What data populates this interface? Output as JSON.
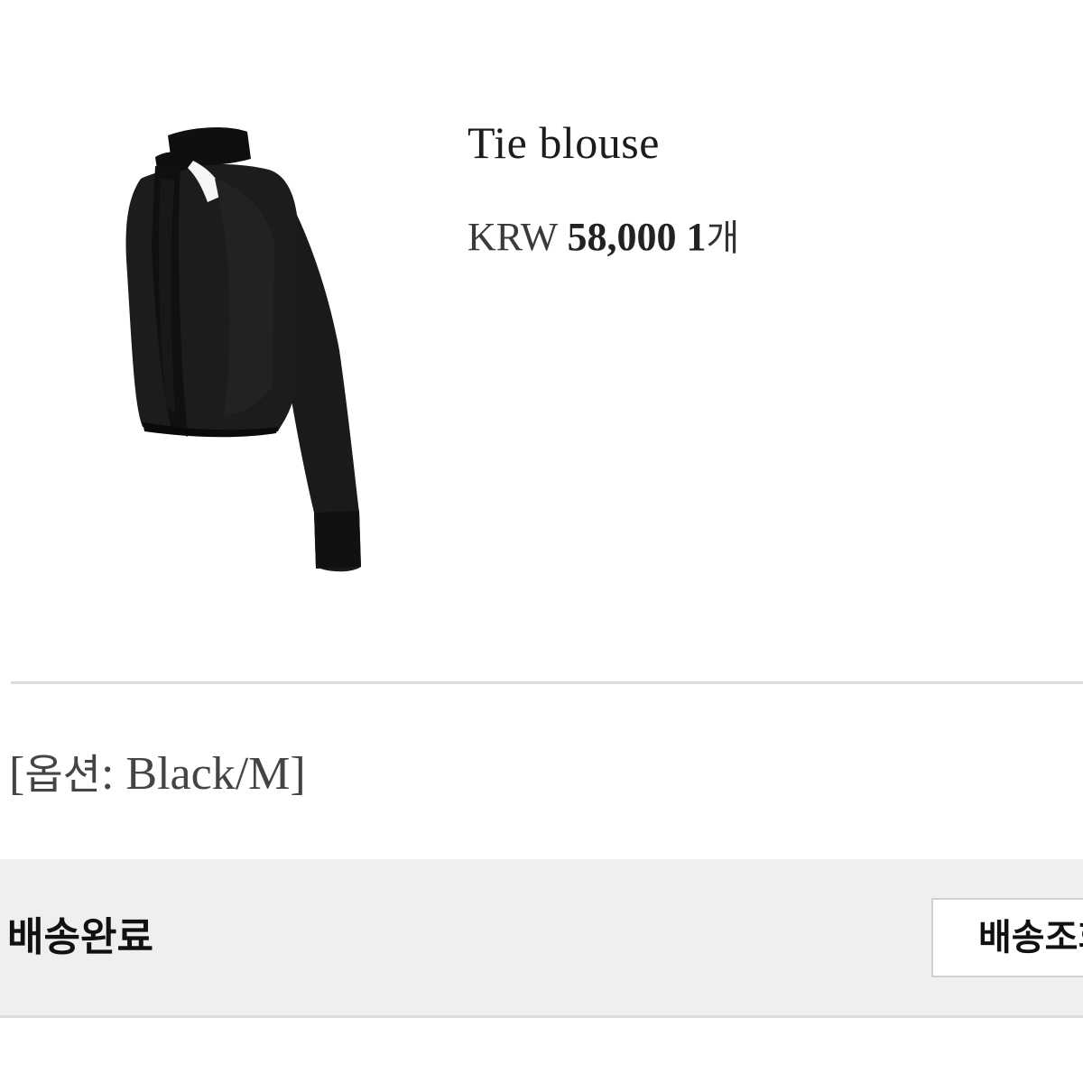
{
  "product": {
    "name": "Tie blouse",
    "currency": "KRW",
    "price": "58,000",
    "quantity_num": "1",
    "quantity_unit": "개",
    "image_icon": "black-tie-blouse-photo"
  },
  "option": {
    "open_bracket": "[",
    "label": "옵션",
    "separator": ": ",
    "value": "Black/M",
    "close_bracket": "]"
  },
  "order_status": {
    "label": "배송완료",
    "button_label": "배송조회"
  },
  "colors": {
    "status_bar_bg": "#efefef",
    "divider": "#dddddd",
    "text": "#1f1f1f"
  }
}
